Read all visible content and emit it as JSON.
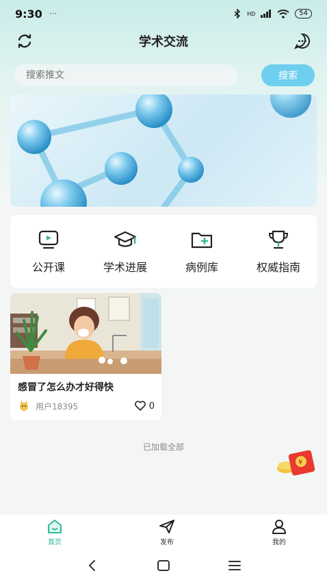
{
  "status_bar": {
    "time": "9:30",
    "dots": "···",
    "signal": "HD",
    "battery": "54"
  },
  "header": {
    "title": "学术交流"
  },
  "search": {
    "placeholder": "搜索推文",
    "button_label": "搜索"
  },
  "quick_nav": [
    {
      "label": "公开课",
      "icon": "tv-play-icon"
    },
    {
      "label": "学术进展",
      "icon": "graduation-cap-icon"
    },
    {
      "label": "病例库",
      "icon": "folder-plus-icon"
    },
    {
      "label": "权威指南",
      "icon": "trophy-icon"
    }
  ],
  "posts": [
    {
      "title": "感冒了怎么办才好得快",
      "author": "用户18395",
      "likes": "0"
    }
  ],
  "feed": {
    "loaded_text": "已加载全部"
  },
  "tabbar": [
    {
      "label": "首页",
      "icon": "home-icon",
      "active": true
    },
    {
      "label": "发布",
      "icon": "send-icon",
      "active": false
    },
    {
      "label": "我的",
      "icon": "user-icon",
      "active": false
    }
  ],
  "colors": {
    "accent": "#2fb99a",
    "search_button": "#6ecff0"
  }
}
